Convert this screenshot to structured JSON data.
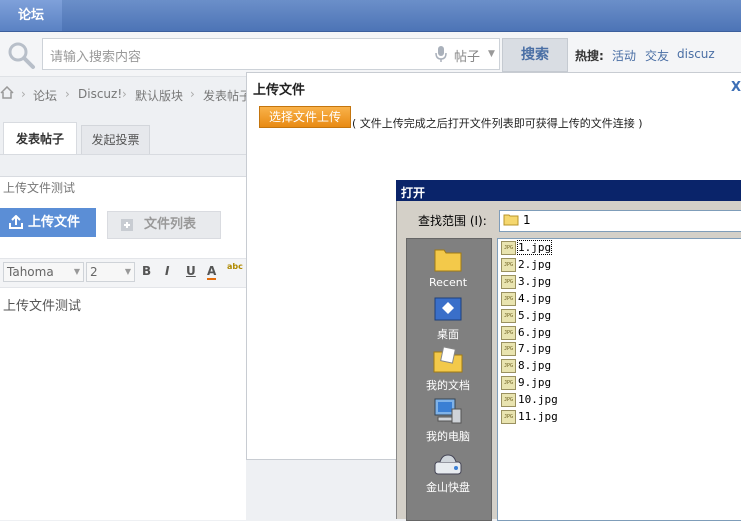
{
  "nav": {
    "forum_tab": "论坛"
  },
  "search": {
    "placeholder": "请输入搜索内容",
    "type": "帖子",
    "button": "搜索",
    "hot_label": "热搜:",
    "hot_links": [
      "活动",
      "交友",
      "discuz"
    ]
  },
  "breadcrumb": [
    "论坛",
    "Discuz!",
    "默认版块",
    "发表帖子"
  ],
  "post_tabs": {
    "post": "发表帖子",
    "poll": "发起投票"
  },
  "subject": "上传文件测试",
  "upload_button": "上传文件",
  "filelist_button": "文件列表",
  "toolbar": {
    "font": "Tahoma",
    "size": "2",
    "bold": "B",
    "italic": "I",
    "underline": "U",
    "color": "A",
    "abc": "abc"
  },
  "editor_text": "上传文件测试",
  "upload_dialog": {
    "title": "上传文件",
    "close": "X",
    "choose_button": "选择文件上传",
    "hint": "( 文件上传完成之后打开文件列表即可获得上传的文件连接 )"
  },
  "open_dialog": {
    "title": "打开",
    "lookin_label": "查找范围 (I):",
    "lookin_value": "1",
    "places": [
      "Recent",
      "桌面",
      "我的文档",
      "我的电脑",
      "金山快盘"
    ],
    "files": [
      "1.jpg",
      "2.jpg",
      "3.jpg",
      "4.jpg",
      "5.jpg",
      "6.jpg",
      "7.jpg",
      "8.jpg",
      "9.jpg",
      "10.jpg",
      "11.jpg"
    ]
  }
}
